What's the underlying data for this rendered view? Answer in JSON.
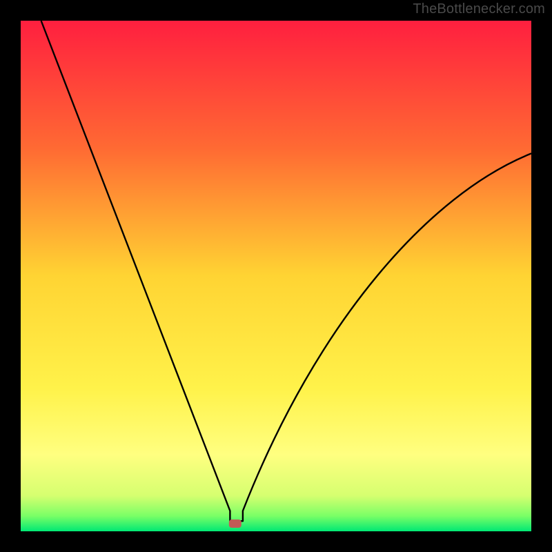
{
  "watermark": "TheBottlenecker.com",
  "chart_data": {
    "type": "line",
    "title": "",
    "xlabel": "",
    "ylabel": "",
    "xlim": [
      0,
      100
    ],
    "ylim": [
      0,
      100
    ],
    "grid": false,
    "legend": false,
    "marker": {
      "x": 42,
      "y": 1.5
    },
    "background_gradient": {
      "stops": [
        {
          "pct": 0,
          "color": "#ff1f3f"
        },
        {
          "pct": 25,
          "color": "#ff6a33"
        },
        {
          "pct": 50,
          "color": "#ffd433"
        },
        {
          "pct": 72,
          "color": "#fff24a"
        },
        {
          "pct": 85,
          "color": "#ffff80"
        },
        {
          "pct": 93,
          "color": "#d6ff70"
        },
        {
          "pct": 97,
          "color": "#7aff66"
        },
        {
          "pct": 100,
          "color": "#00e874"
        }
      ]
    },
    "series": [
      {
        "name": "curve",
        "segments": [
          {
            "kind": "line",
            "from": {
              "x": 4,
              "y": 100
            },
            "to": {
              "x": 41,
              "y": 4
            }
          },
          {
            "kind": "line",
            "from": {
              "x": 41,
              "y": 4
            },
            "to": {
              "x": 41,
              "y": 2
            }
          },
          {
            "kind": "line",
            "from": {
              "x": 41,
              "y": 2
            },
            "to": {
              "x": 43.5,
              "y": 2
            }
          },
          {
            "kind": "cubic",
            "from": {
              "x": 43.5,
              "y": 4
            },
            "c1": {
              "x": 58,
              "y": 41
            },
            "c2": {
              "x": 80,
              "y": 66
            },
            "to": {
              "x": 100,
              "y": 74
            }
          }
        ]
      }
    ]
  }
}
